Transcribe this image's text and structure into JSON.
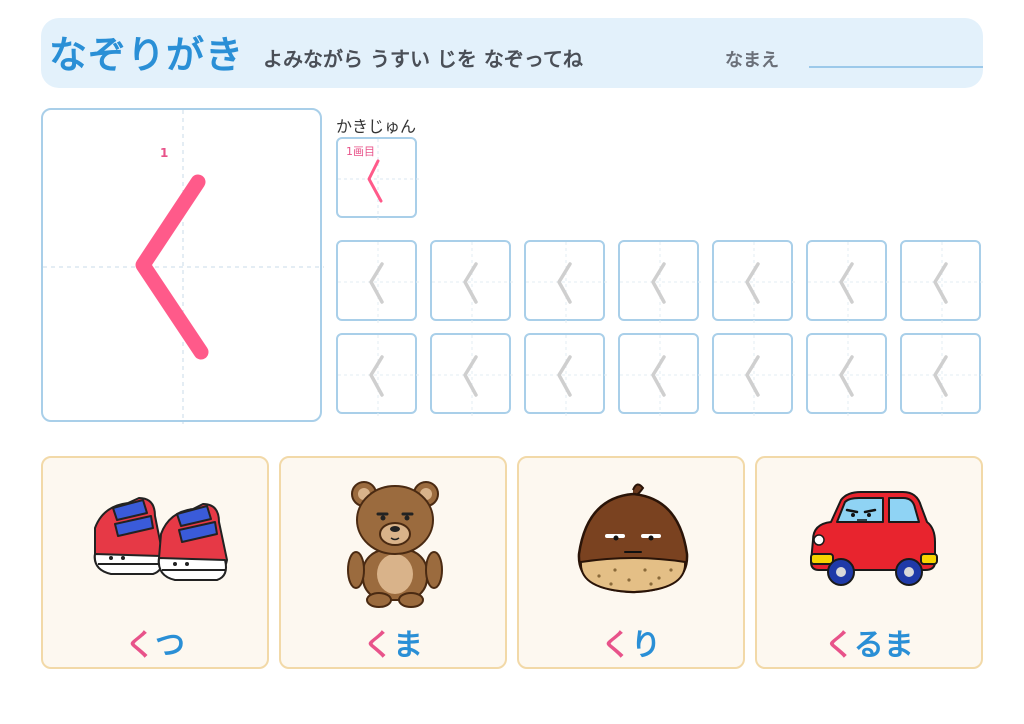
{
  "header": {
    "title": "なぞりがき",
    "subtitle": "よみながら うすい じを なぞってね",
    "name_label": "なまえ"
  },
  "practice": {
    "character": "く",
    "stroke_number": "1"
  },
  "stroke_order": {
    "label": "かきじゅん",
    "steps": [
      {
        "label": "1画目"
      }
    ]
  },
  "trace_grid": {
    "rows": 2,
    "cols": 7
  },
  "cards": [
    {
      "icon": "sneakers-icon",
      "highlight": "く",
      "rest": "つ"
    },
    {
      "icon": "bear-icon",
      "highlight": "く",
      "rest": "ま"
    },
    {
      "icon": "chestnut-icon",
      "highlight": "く",
      "rest": "り"
    },
    {
      "icon": "car-icon",
      "highlight": "く",
      "rest": "るま"
    }
  ],
  "colors": {
    "accent_blue": "#2a8fd6",
    "stroke_pink": "#ff5a8a",
    "box_border": "#a9cfe9",
    "card_border": "#f2d9a8"
  }
}
